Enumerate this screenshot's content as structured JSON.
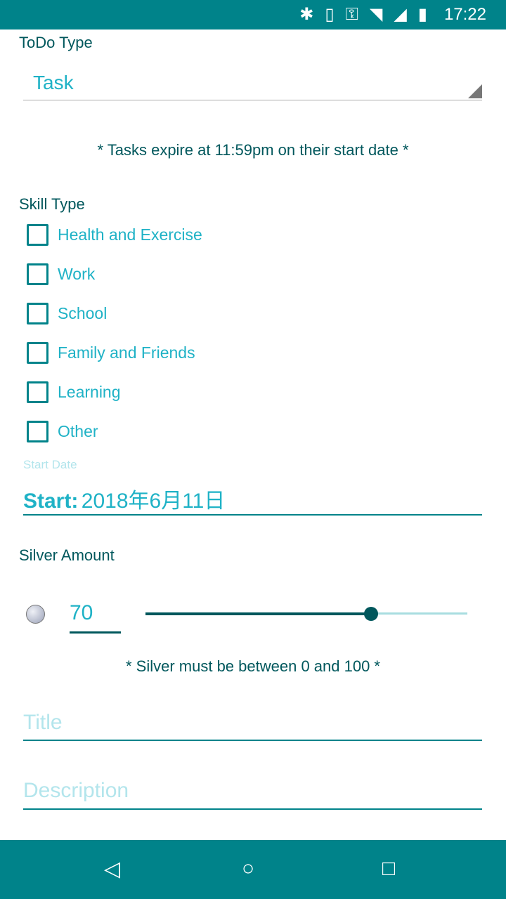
{
  "status_bar": {
    "time": "17:22",
    "icons": [
      "bluetooth-icon",
      "vibrate-icon",
      "vpn-key-icon",
      "wifi-off-icon",
      "signal-icon",
      "battery-icon"
    ]
  },
  "todo_type": {
    "label": "ToDo Type",
    "selected": "Task"
  },
  "task_note": "* Tasks expire at 11:59pm on their start date *",
  "skill_type": {
    "label": "Skill Type",
    "items": [
      {
        "label": "Health and Exercise",
        "checked": false
      },
      {
        "label": "Work",
        "checked": false
      },
      {
        "label": "School",
        "checked": false
      },
      {
        "label": "Family and Friends",
        "checked": false
      },
      {
        "label": "Learning",
        "checked": false
      },
      {
        "label": "Other",
        "checked": false
      }
    ]
  },
  "start_date": {
    "hint": "Start Date",
    "prefix": "Start:",
    "value": "2018年6月11日"
  },
  "silver": {
    "label": "Silver Amount",
    "value": "70",
    "slider_min": 0,
    "slider_max": 100,
    "slider_value": 70,
    "note": "* Silver must be between 0 and 100 *"
  },
  "title_field": {
    "placeholder": "Title",
    "value": ""
  },
  "description_field": {
    "placeholder": "Description",
    "value": ""
  },
  "colors": {
    "primary": "#00838a",
    "accent": "#1fb2c6",
    "text": "#00575c"
  }
}
